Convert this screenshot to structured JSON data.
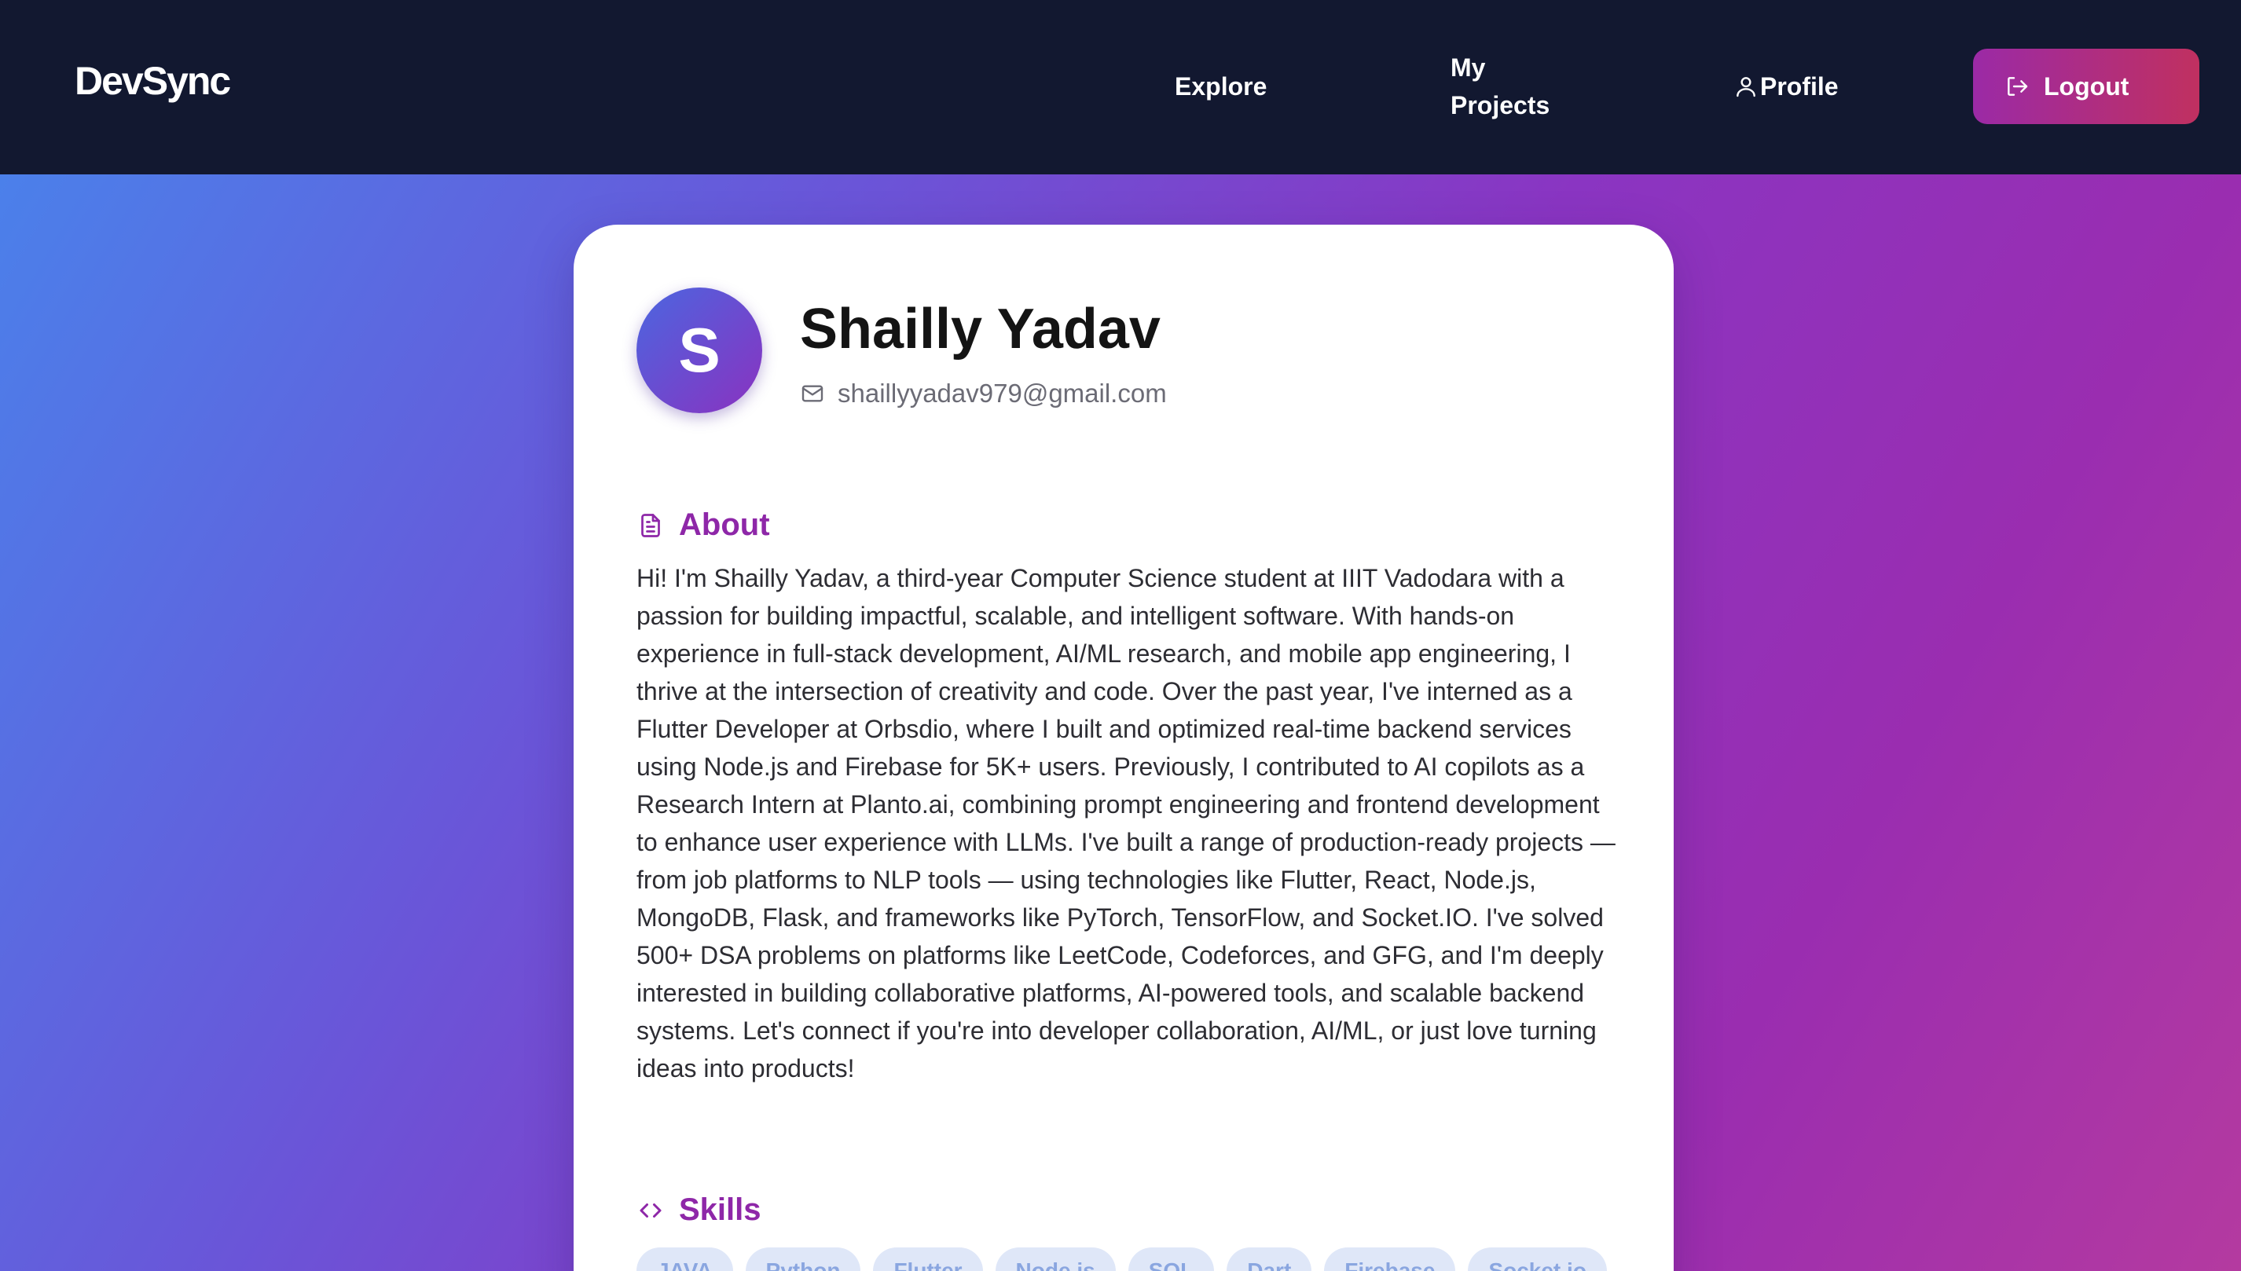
{
  "navbar": {
    "brand": "DevSync",
    "links": {
      "explore": "Explore",
      "my_projects": "My Projects",
      "profile": "Profile"
    },
    "logout_label": "Logout"
  },
  "profile": {
    "initial": "S",
    "name": "Shailly Yadav",
    "email": "shaillyyadav979@gmail.com",
    "about_title": "About",
    "about_text": "Hi! I'm Shailly Yadav, a third-year Computer Science student at IIIT Vadodara with a passion for building impactful, scalable, and intelligent software. With hands-on experience in full-stack development, AI/ML research, and mobile app engineering, I thrive at the intersection of creativity and code. Over the past year, I've interned as a Flutter Developer at Orbsdio, where I built and optimized real-time backend services using Node.js and Firebase for 5K+ users. Previously, I contributed to AI copilots as a Research Intern at Planto.ai, combining prompt engineering and frontend development to enhance user experience with LLMs. I've built a range of production-ready projects — from job platforms to NLP tools — using technologies like Flutter, React, Node.js, MongoDB, Flask, and frameworks like PyTorch, TensorFlow, and Socket.IO. I've solved 500+ DSA problems on platforms like LeetCode, Codeforces, and GFG, and I'm deeply interested in building collaborative platforms, AI-powered tools, and scalable backend systems. Let's connect if you're into developer collaboration, AI/ML, or just love turning ideas into products!",
    "skills_title": "Skills",
    "skills": [
      "JAVA",
      "Python",
      "Flutter",
      "Node.js",
      "SQL",
      "Dart",
      "Firebase",
      "Socket.io"
    ]
  },
  "colors": {
    "navbar_bg": "#121830",
    "accent": "#8e27a8",
    "logout_gradient": [
      "#9b2aa6",
      "#c03060"
    ]
  },
  "icons": {
    "profile": "user-icon",
    "logout": "logout-icon",
    "email": "mail-icon",
    "about": "document-icon",
    "skills": "code-icon"
  }
}
